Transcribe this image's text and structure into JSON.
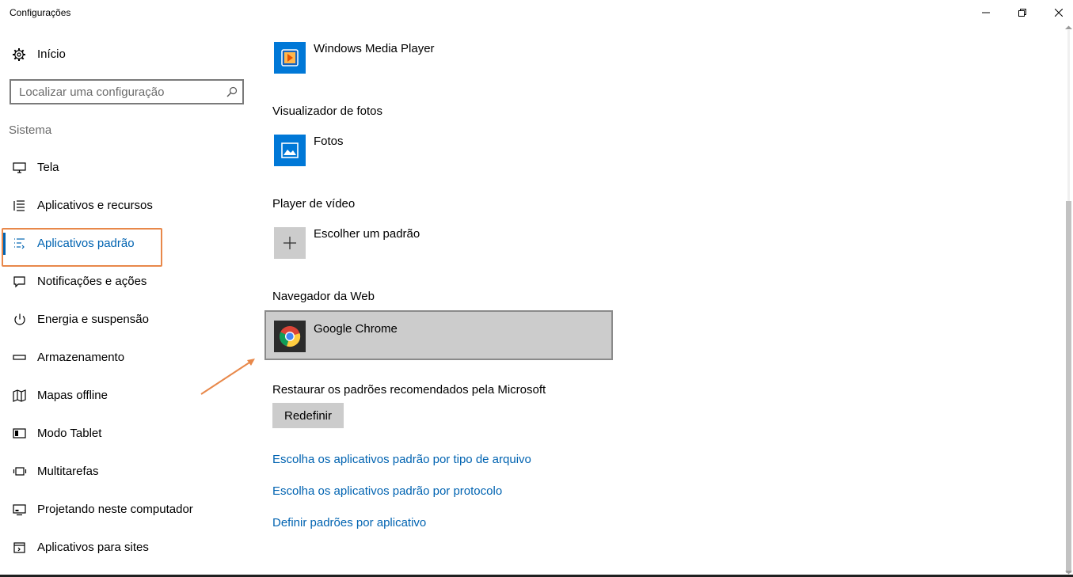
{
  "window": {
    "title": "Configurações"
  },
  "sidebar": {
    "home_label": "Início",
    "search_placeholder": "Localizar uma configuração",
    "section_label": "Sistema",
    "items": [
      {
        "label": "Tela",
        "icon": "monitor-icon"
      },
      {
        "label": "Aplicativos e recursos",
        "icon": "list-icon"
      },
      {
        "label": "Aplicativos padrão",
        "icon": "default-apps-icon",
        "selected": true
      },
      {
        "label": "Notificações e ações",
        "icon": "notification-icon"
      },
      {
        "label": "Energia e suspensão",
        "icon": "power-icon"
      },
      {
        "label": "Armazenamento",
        "icon": "storage-icon"
      },
      {
        "label": "Mapas offline",
        "icon": "map-icon"
      },
      {
        "label": "Modo Tablet",
        "icon": "tablet-icon"
      },
      {
        "label": "Multitarefas",
        "icon": "multitask-icon"
      },
      {
        "label": "Projetando neste computador",
        "icon": "projecting-icon"
      },
      {
        "label": "Aplicativos para sites",
        "icon": "apps-for-websites-icon"
      }
    ]
  },
  "main": {
    "music_app": {
      "name": "Windows Media Player",
      "icon": "windows-media-player-icon"
    },
    "photo_group_label": "Visualizador de fotos",
    "photo_app": {
      "name": "Fotos",
      "icon": "photos-icon"
    },
    "video_group_label": "Player de vídeo",
    "video_app": {
      "name": "Escolher um padrão",
      "icon": "plus-icon"
    },
    "browser_group_label": "Navegador da Web",
    "browser_app": {
      "name": "Google Chrome",
      "icon": "chrome-icon"
    },
    "restore_label": "Restaurar os padrões recomendados pela Microsoft",
    "reset_button": "Redefinir",
    "links": [
      "Escolha os aplicativos padrão por tipo de arquivo",
      "Escolha os aplicativos padrão por protocolo",
      "Definir padrões por aplicativo"
    ]
  },
  "colors": {
    "accent": "#0063b1",
    "highlight_annotation": "#e8884a",
    "selected_app_bg": "#cccccc",
    "tile_blue": "#0078d7"
  }
}
